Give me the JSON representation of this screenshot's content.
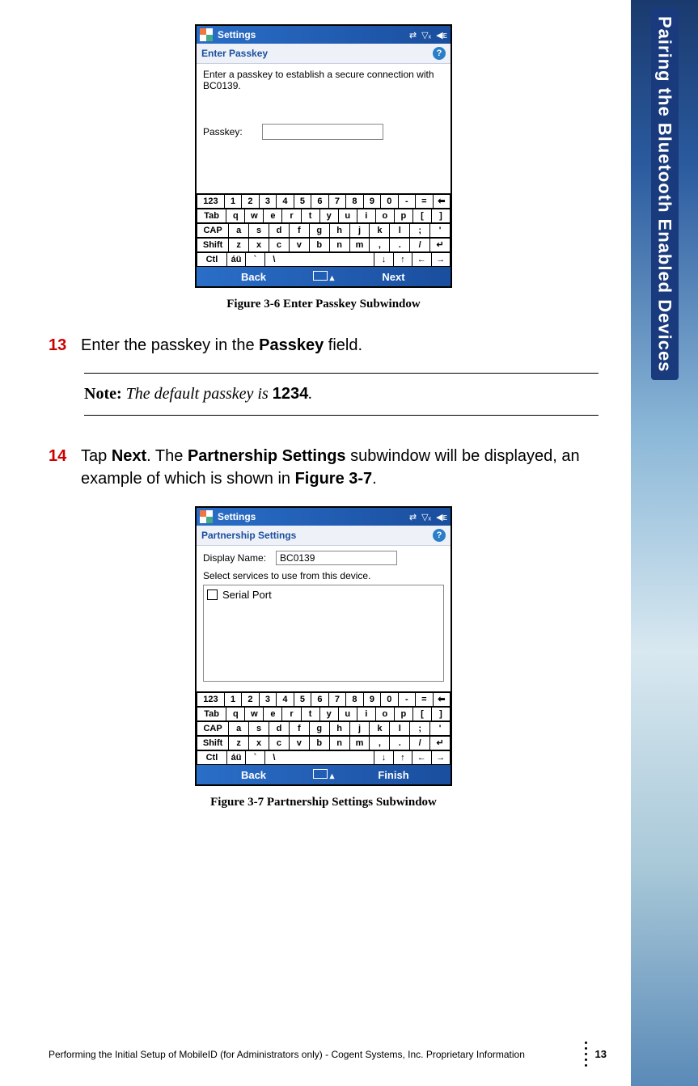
{
  "sideTab": "Pairing the Bluetooth Enabled Devices",
  "figure1": {
    "titleBar": "Settings",
    "subHeader": "Enter Passkey",
    "instruction": "Enter a passkey to establish a secure connection with BC0139.",
    "passkeyLabel": "Passkey:",
    "passkeyValue": "",
    "backBtn": "Back",
    "nextBtn": "Next",
    "caption": "Figure 3-6 Enter Passkey Subwindow"
  },
  "step13": {
    "num": "13",
    "textA": "Enter the passkey in the ",
    "bold1": "Passkey",
    "textB": " field."
  },
  "note": {
    "lead": "Note:",
    "text": " The default passkey is ",
    "val": "1234",
    "tail": "."
  },
  "step14": {
    "num": "14",
    "textA": "Tap ",
    "bold1": "Next",
    "textB": ". The ",
    "bold2": "Partnership Settings",
    "textC": " subwindow will be displayed, an example of which is shown in ",
    "bold3": "Figure 3-7",
    "textD": "."
  },
  "figure2": {
    "titleBar": "Settings",
    "subHeader": "Partnership Settings",
    "dispLabel": "Display Name:",
    "dispValue": "BC0139",
    "svcInstr": "Select services to use from this device.",
    "svcItem": "Serial Port",
    "backBtn": "Back",
    "finishBtn": "Finish",
    "caption": "Figure 3-7 Partnership Settings Subwindow"
  },
  "keyboard": {
    "r1": [
      "123",
      "1",
      "2",
      "3",
      "4",
      "5",
      "6",
      "7",
      "8",
      "9",
      "0",
      "-",
      "=",
      "⬅"
    ],
    "r2": [
      "Tab",
      "q",
      "w",
      "e",
      "r",
      "t",
      "y",
      "u",
      "i",
      "o",
      "p",
      "[",
      "]"
    ],
    "r3": [
      "CAP",
      "a",
      "s",
      "d",
      "f",
      "g",
      "h",
      "j",
      "k",
      "l",
      ";",
      "'"
    ],
    "r4": [
      "Shift",
      "z",
      "x",
      "c",
      "v",
      "b",
      "n",
      "m",
      ",",
      ".",
      "/",
      "↵"
    ],
    "r5": [
      "Ctl",
      "áü",
      "`",
      "\\",
      "",
      "",
      "",
      "",
      "",
      "↓",
      "↑",
      "←",
      "→"
    ]
  },
  "footer": {
    "text": "Performing the Initial Setup of MobileID (for Administrators only)  - Cogent Systems, Inc. Proprietary Information",
    "page": "13"
  }
}
